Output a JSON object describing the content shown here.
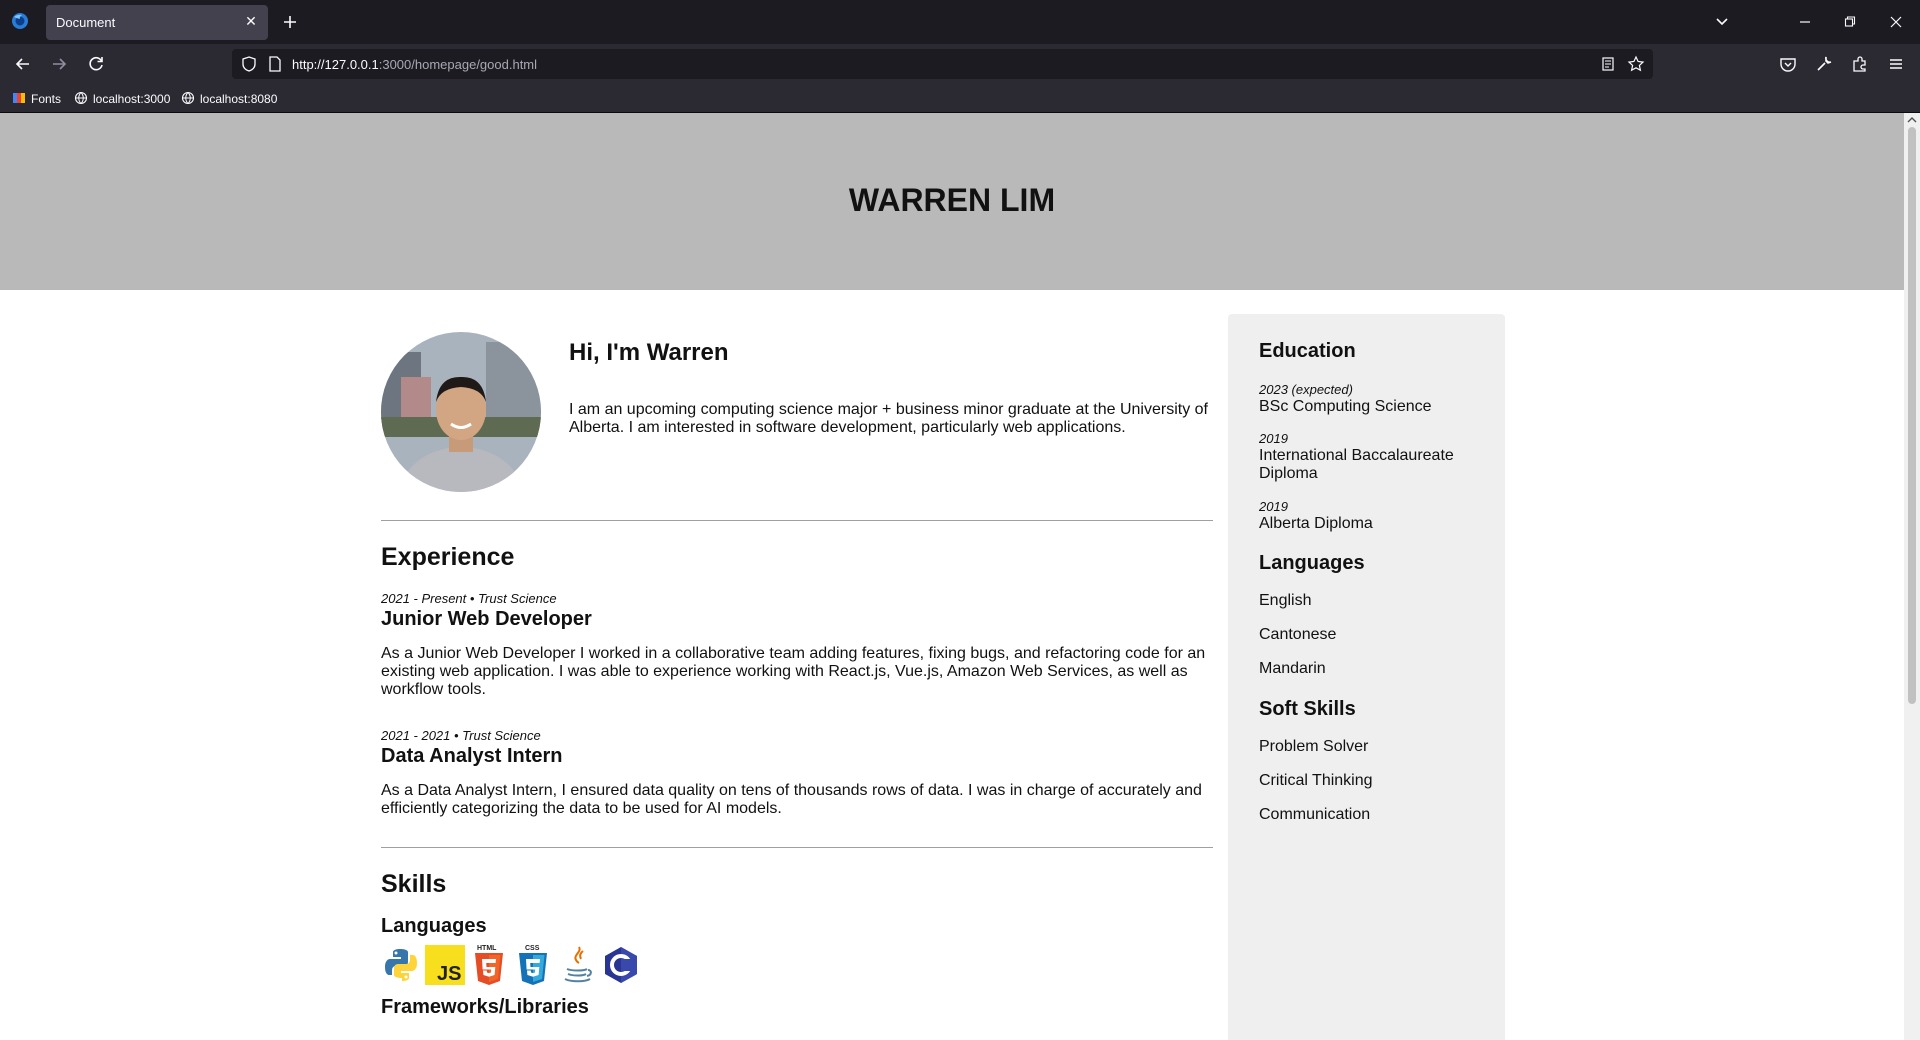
{
  "browser": {
    "tab_title": "Document",
    "url_host": "http://127.0.0.1",
    "url_rest": ":3000/homepage/good.html",
    "bookmarks": [
      {
        "label": "Fonts",
        "icon": "fonts-icon"
      },
      {
        "label": "localhost:3000",
        "icon": "globe-icon"
      },
      {
        "label": "localhost:8080",
        "icon": "globe-icon"
      }
    ]
  },
  "hero": {
    "name": "WARREN LIM"
  },
  "intro": {
    "heading": "Hi, I'm Warren",
    "text": "I am an upcoming computing science major + business minor graduate at the University of Alberta. I am interested in software development, particularly web applications."
  },
  "experience": {
    "title": "Experience",
    "jobs": [
      {
        "meta": "2021 - Present • Trust Science",
        "title": "Junior Web Developer",
        "desc": "As a Junior Web Developer I worked in a collaborative team adding features, fixing bugs, and refactoring code for an existing web application. I was able to experience working with React.js, Vue.js, Amazon Web Services, as well as workflow tools."
      },
      {
        "meta": "2021 - 2021 • Trust Science",
        "title": "Data Analyst Intern",
        "desc": "As a Data Analyst Intern, I ensured data quality on tens of thousands rows of data. I was in charge of accurately and efficiently categorizing the data to be used for AI models."
      }
    ]
  },
  "skills": {
    "title": "Skills",
    "languages_title": "Languages",
    "language_icons": [
      "python-icon",
      "javascript-icon",
      "html5-icon",
      "css3-icon",
      "java-icon",
      "c-icon"
    ],
    "frameworks_title": "Frameworks/Libraries"
  },
  "sidebar": {
    "education_title": "Education",
    "education": [
      {
        "year": "2023 (expected)",
        "degree": "BSc Computing Science"
      },
      {
        "year": "2019",
        "degree": "International Baccalaureate Diploma"
      },
      {
        "year": "2019",
        "degree": "Alberta Diploma"
      }
    ],
    "languages_title": "Languages",
    "languages": [
      "English",
      "Cantonese",
      "Mandarin"
    ],
    "soft_skills_title": "Soft Skills",
    "soft_skills": [
      "Problem Solver",
      "Critical Thinking",
      "Communication"
    ]
  }
}
